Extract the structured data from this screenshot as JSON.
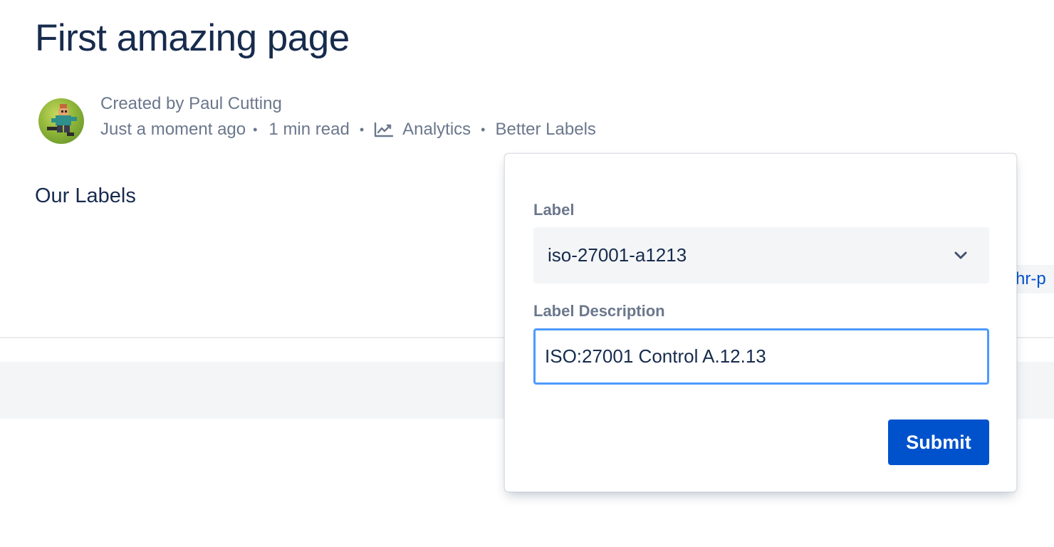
{
  "page": {
    "title": "First amazing page"
  },
  "byline": {
    "created_by": "Created by Paul Cutting",
    "time": "Just a moment ago",
    "read_time": "1 min read",
    "analytics_label": "Analytics",
    "analytics_icon": "line-chart-icon",
    "better_labels": "Better Labels",
    "separator": "•"
  },
  "content": {
    "heading": "Our Labels",
    "partial_label": "hr-p"
  },
  "popup": {
    "label_field": {
      "label": "Label",
      "value": "iso-27001-a1213"
    },
    "description_field": {
      "label": "Label Description",
      "value": "ISO:27001 Control A.12.13"
    },
    "submit_label": "Submit"
  },
  "colors": {
    "primary": "#0052cc",
    "focus_border": "#4c9aff",
    "text": "#172b4d",
    "subtle_text": "#6b778c",
    "field_background": "#f4f5f7"
  }
}
